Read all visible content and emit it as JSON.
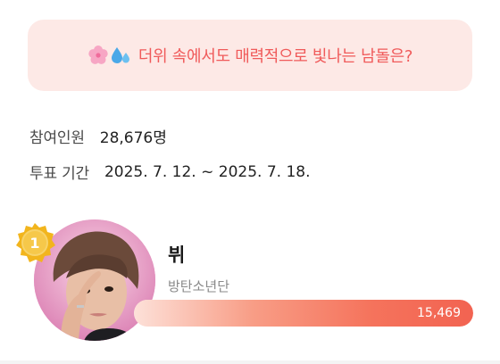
{
  "banner": {
    "icons": [
      "cherry-blossom-icon",
      "sweat-droplets-icon"
    ],
    "title": "더위 속에서도 매력적으로 빛나는 남돌은?"
  },
  "info": {
    "participants_label": "참여인원",
    "participants_value": "28,676명",
    "period_label": "투표 기간",
    "period_value": "2025. 7. 12. ~ 2025. 7. 18."
  },
  "ranking": [
    {
      "rank": "1",
      "name": "뷔",
      "group": "방탄소년단",
      "votes": "15,469",
      "bar_fill_percent": 100
    }
  ],
  "colors": {
    "accent": "#f26351",
    "banner_bg": "#fde9e6",
    "medal_gold": "#f2b51d"
  }
}
